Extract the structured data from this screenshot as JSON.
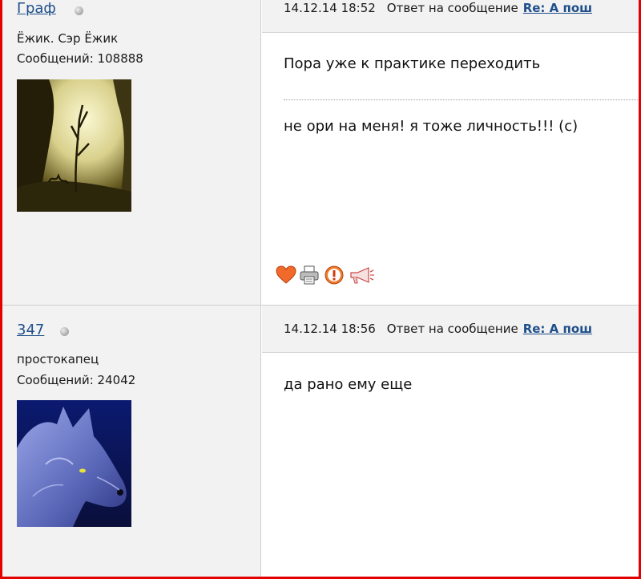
{
  "posts": [
    {
      "username": "Граф",
      "online_status": "offline",
      "user_title": "Ёжик. Сэр Ёжик",
      "post_count": "Сообщений: 108888",
      "avatar": "twilight-tree-avatar",
      "date": "14.12.14 18:52",
      "reply_label": "Ответ на сообщение",
      "reply_link": "Re: А пош",
      "body": "Пора уже к практике переходить",
      "signature": "не ори на меня! я тоже личность!!! (с)",
      "actions": [
        "heart-icon",
        "print-icon",
        "warning-icon",
        "megaphone-icon"
      ]
    },
    {
      "username": "347",
      "online_status": "offline",
      "user_title": "простокапец",
      "post_count": "Сообщений: 24042",
      "avatar": "wolf-avatar",
      "date": "14.12.14 18:56",
      "reply_label": "Ответ на сообщение",
      "reply_link": "Re: А пош",
      "body": "да рано ему еще"
    }
  ],
  "colors": {
    "frame": "#e30000",
    "panel": "#f2f2f2",
    "link": "#1f4f8b"
  }
}
